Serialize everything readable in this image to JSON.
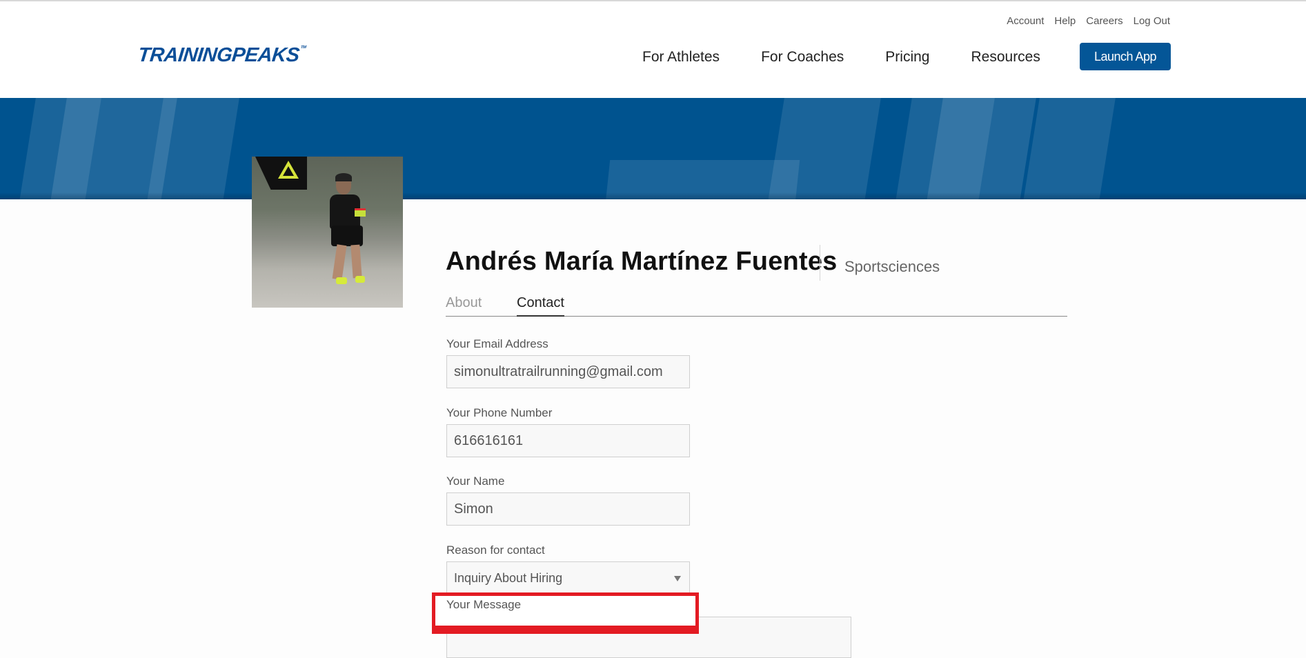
{
  "header": {
    "logo": "TRAININGPEAKS",
    "logo_tm": "TM",
    "utility_links": [
      "Account",
      "Help",
      "Careers",
      "Log Out"
    ],
    "nav": [
      "For Athletes",
      "For Coaches",
      "Pricing",
      "Resources"
    ],
    "launch_button": "Launch App"
  },
  "colors": {
    "brand_blue": "#045697",
    "banner_blue": "#00538f",
    "highlight_red": "#e31b23"
  },
  "profile": {
    "name": "Andrés María Martínez Fuentes",
    "company": "Sportsciences",
    "photo_alt": "coach-photo"
  },
  "tabs": [
    {
      "label": "About",
      "active": false
    },
    {
      "label": "Contact",
      "active": true
    }
  ],
  "form": {
    "email": {
      "label": "Your Email Address",
      "value": "simonultratrailrunning@gmail.com"
    },
    "phone": {
      "label": "Your Phone Number",
      "value": "616616161"
    },
    "name": {
      "label": "Your Name",
      "value": "Simon"
    },
    "reason": {
      "label": "Reason for contact",
      "selected": "Inquiry About Hiring"
    },
    "message": {
      "label": "Your Message",
      "value": ""
    }
  }
}
